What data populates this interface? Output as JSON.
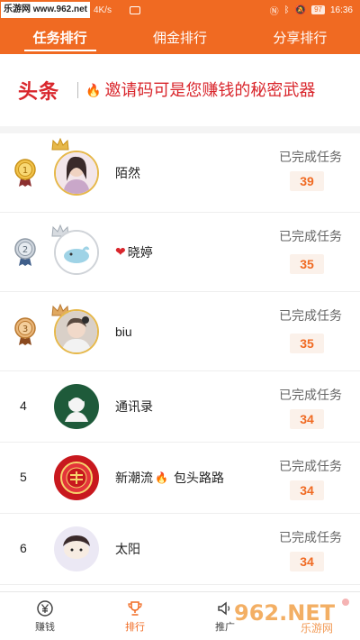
{
  "status": {
    "watermark": "乐游网 www.962.net",
    "speed": "4K/s",
    "battery": "97",
    "time": "16:36"
  },
  "tabs": [
    {
      "label": "任务排行",
      "active": true
    },
    {
      "label": "佣金排行",
      "active": false
    },
    {
      "label": "分享排行",
      "active": false
    }
  ],
  "banner": {
    "logo": "头条",
    "text": "邀请码可是您赚钱的秘密武器"
  },
  "colors": {
    "accent": "#f06a22",
    "headline_red": "#d9262c",
    "count_bg": "#fbf1ea"
  },
  "ranking": {
    "done_label": "已完成任务",
    "rows": [
      {
        "rank": "1",
        "medal": "gold-medal-icon",
        "name": "陌然",
        "count": "39"
      },
      {
        "rank": "2",
        "medal": "silver-medal-icon",
        "name": "晓婷",
        "count": "35"
      },
      {
        "rank": "3",
        "medal": "bronze-medal-icon",
        "name": "biu",
        "count": "35"
      },
      {
        "rank": "4",
        "name": "通讯录",
        "count": "34"
      },
      {
        "rank": "5",
        "name": "新潮流",
        "name_suffix": "包头路路",
        "count": "34"
      },
      {
        "rank": "6",
        "name": "太阳",
        "count": "34"
      }
    ]
  },
  "bottom_nav": [
    {
      "label": "赚钱",
      "icon": "yen-icon",
      "active": false
    },
    {
      "label": "排行",
      "icon": "trophy-icon",
      "active": true
    },
    {
      "label": "推广",
      "icon": "speaker-icon",
      "active": false
    }
  ],
  "overlay_watermark": {
    "brand": "962.NET",
    "sub": "乐游网"
  }
}
